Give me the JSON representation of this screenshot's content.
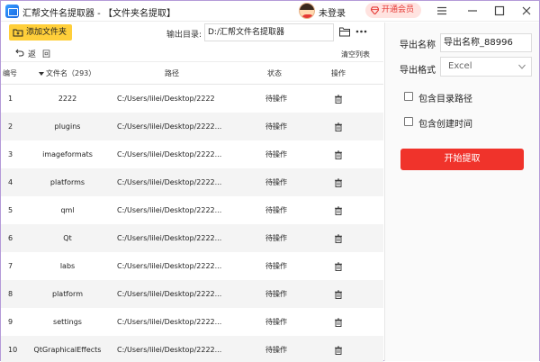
{
  "titlebar": {
    "app_title": "汇帮文件名提取器 - 【文件夹名提取】",
    "login_text": "未登录",
    "vip_label": "开通会员",
    "icons": [
      "app-logo-icon",
      "avatar",
      "diamond-icon",
      "menu-icon",
      "minimize-icon",
      "maximize-icon",
      "close-icon"
    ]
  },
  "toolbar": {
    "add_folder_label": "添加文件夹",
    "output_dir_label": "输出目录:",
    "output_dir_value": "D:/汇帮文件名提取器",
    "back_label": "返",
    "back_label2": "回",
    "clear_list_label": "清空列表"
  },
  "table": {
    "headers": {
      "index": "编号",
      "name": "文件名（293）",
      "path": "路径",
      "status": "状态",
      "op": "操作"
    },
    "rows": [
      {
        "index": "1",
        "name": "2222",
        "path": "C:/Users/lilei/Desktop/2222",
        "status": "待操作"
      },
      {
        "index": "2",
        "name": "plugins",
        "path": "C:/Users/lilei/Desktop/2222...",
        "status": "待操作"
      },
      {
        "index": "3",
        "name": "imageformats",
        "path": "C:/Users/lilei/Desktop/2222...",
        "status": "待操作"
      },
      {
        "index": "4",
        "name": "platforms",
        "path": "C:/Users/lilei/Desktop/2222...",
        "status": "待操作"
      },
      {
        "index": "5",
        "name": "qml",
        "path": "C:/Users/lilei/Desktop/2222...",
        "status": "待操作"
      },
      {
        "index": "6",
        "name": "Qt",
        "path": "C:/Users/lilei/Desktop/2222...",
        "status": "待操作"
      },
      {
        "index": "7",
        "name": "labs",
        "path": "C:/Users/lilei/Desktop/2222...",
        "status": "待操作"
      },
      {
        "index": "8",
        "name": "platform",
        "path": "C:/Users/lilei/Desktop/2222...",
        "status": "待操作"
      },
      {
        "index": "9",
        "name": "settings",
        "path": "C:/Users/lilei/Desktop/2222...",
        "status": "待操作"
      },
      {
        "index": "10",
        "name": "QtGraphicalEffects",
        "path": "C:/Users/lilei/Desktop/2222...",
        "status": "待操作"
      }
    ]
  },
  "right_panel": {
    "export_name_label": "导出名称",
    "export_name_value": "导出名称_88996",
    "export_format_label": "导出格式",
    "export_format_value": "Excel",
    "include_path_label": "包含目录路径",
    "include_path_checked": false,
    "include_time_label": "包含创建时间",
    "include_time_checked": false,
    "start_button_label": "开始提取"
  },
  "colors": {
    "accent_yellow": "#ffcf3a",
    "start_red": "#f0332b",
    "vip_red": "#e53935",
    "frame_purple": "#b49ad8"
  }
}
